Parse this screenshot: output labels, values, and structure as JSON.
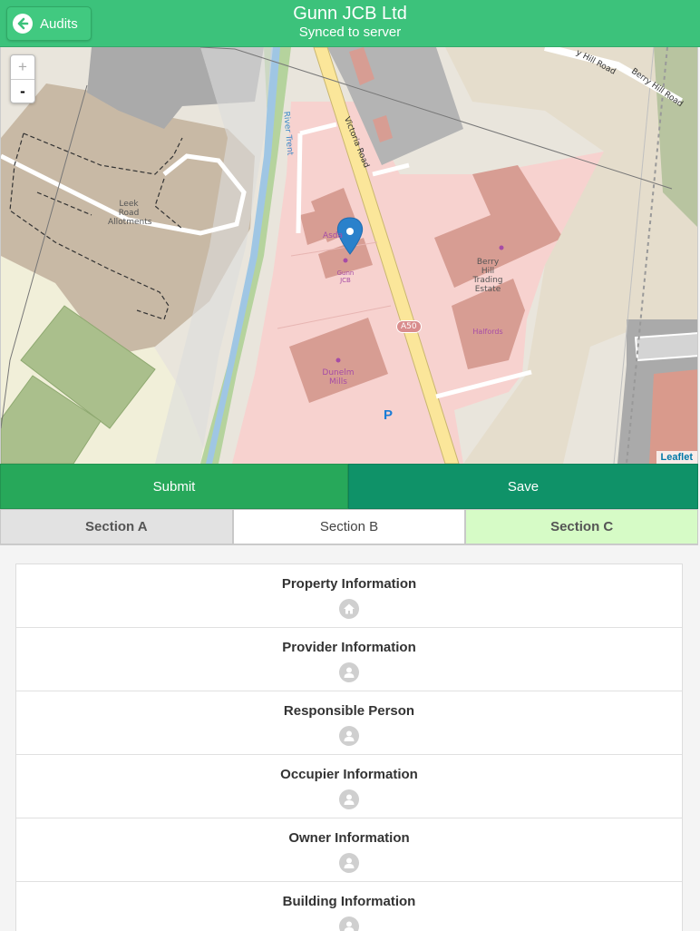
{
  "header": {
    "back_label": "Audits",
    "title": "Gunn JCB Ltd",
    "subtitle": "Synced to server"
  },
  "map": {
    "zoom_in": "+",
    "zoom_out": "-",
    "attribution": "Leaflet",
    "labels": {
      "river": "River Trent",
      "victoria_road": "Victoria Road",
      "berry_hill_road_1": "y Hill Road",
      "berry_hill_road_2": "Berry Hill Road",
      "allotments_1": "Leek",
      "allotments_2": "Road",
      "allotments_3": "Allotments",
      "asda": "Asda",
      "gunn_1": "Gunn",
      "gunn_2": "JCB",
      "berry_hill_1": "Berry",
      "berry_hill_2": "Hill",
      "berry_hill_3": "Trading",
      "berry_hill_4": "Estate",
      "halfords": "Halfords",
      "dunelm_1": "Dunelm",
      "dunelm_2": "Mills",
      "a50": "A50",
      "parking": "P"
    }
  },
  "actions": {
    "submit_label": "Submit",
    "save_label": "Save"
  },
  "tabs": [
    {
      "label": "Section A"
    },
    {
      "label": "Section B"
    },
    {
      "label": "Section C"
    }
  ],
  "sections": [
    {
      "label": "Property Information",
      "icon": "home-icon"
    },
    {
      "label": "Provider Information",
      "icon": "user-icon"
    },
    {
      "label": "Responsible Person",
      "icon": "user-icon"
    },
    {
      "label": "Occupier Information",
      "icon": "user-icon"
    },
    {
      "label": "Owner Information",
      "icon": "user-icon"
    },
    {
      "label": "Building Information",
      "icon": "user-icon"
    }
  ],
  "colors": {
    "header": "#3cc27b",
    "submit": "#27a85a",
    "save": "#0f9268",
    "active_tab_c": "#d6fbc6"
  }
}
